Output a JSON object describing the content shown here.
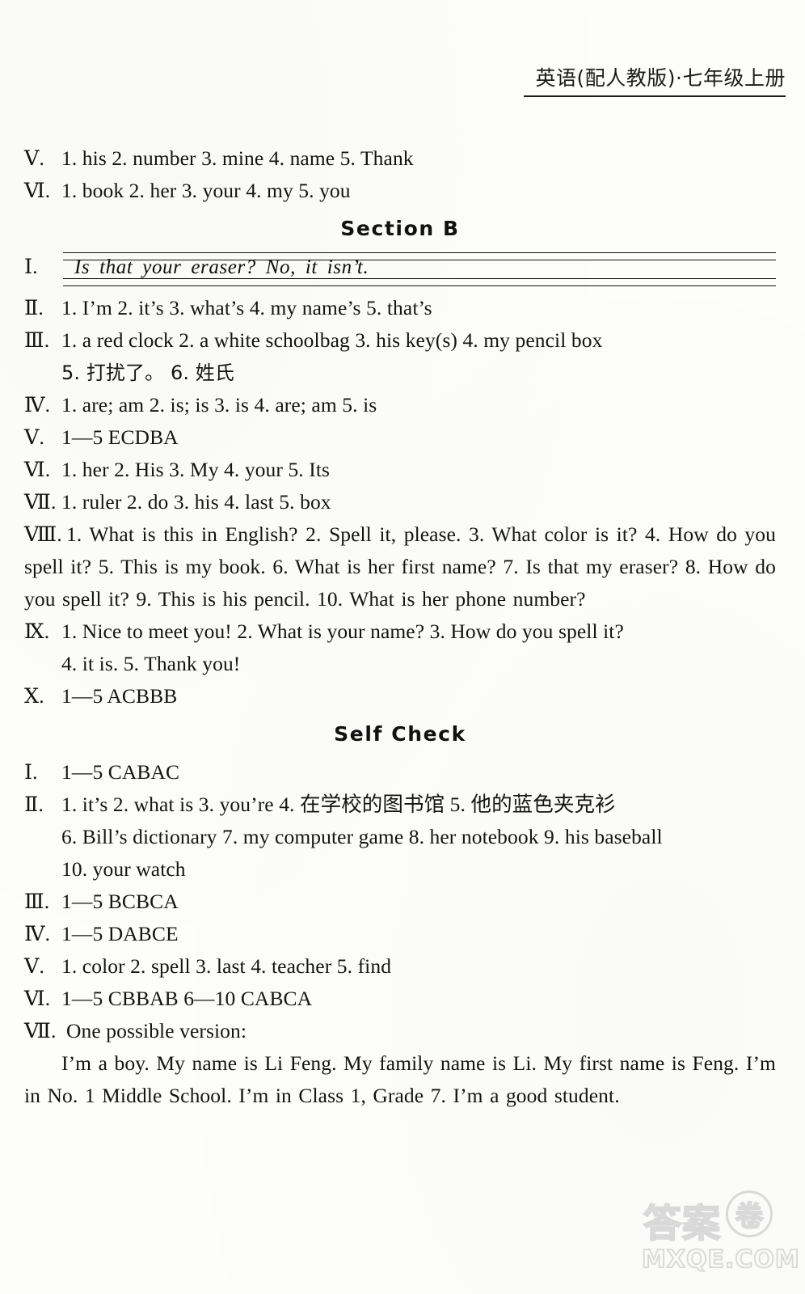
{
  "header": {
    "title": "英语(配人教版)·七年级上册"
  },
  "top_answers": [
    {
      "numeral": "Ⅴ.",
      "text": "1. his  2. number  3. mine  4. name  5. Thank"
    },
    {
      "numeral": "Ⅵ.",
      "text": "1. book  2. her  3. your  4. my  5. you"
    }
  ],
  "section_b": {
    "heading": "Section B",
    "item1": {
      "numeral": "Ⅰ.",
      "handwriting": "Is that your eraser?  No, it isn’t."
    },
    "items": [
      {
        "numeral": "Ⅱ.",
        "lines": [
          "1. I’m  2. it’s  3. what’s  4. my name’s  5. that’s"
        ]
      },
      {
        "numeral": "Ⅲ.",
        "lines": [
          "1. a red clock  2. a white schoolbag  3. his key(s)  4. my pencil box",
          "5. 打扰了。 6. 姓氏"
        ]
      },
      {
        "numeral": "Ⅳ.",
        "lines": [
          "1. are; am  2. is; is  3. is  4. are; am  5. is"
        ]
      },
      {
        "numeral": "Ⅴ.",
        "lines": [
          "1—5  ECDBA"
        ]
      },
      {
        "numeral": "Ⅵ.",
        "lines": [
          "1. her  2. His  3. My  4. your  5. Its"
        ]
      },
      {
        "numeral": "Ⅶ.",
        "lines": [
          "1. ruler  2. do  3. his  4. last  5. box"
        ]
      }
    ],
    "item8": {
      "numeral": "Ⅷ.",
      "paragraph": "1. What is this in English?  2. Spell it, please.  3. What color is it?  4. How do you spell it?  5. This is my book.  6. What is her first name?  7. Is that my eraser?  8. How do you spell it?  9. This is his pencil.  10. What is her phone number?"
    },
    "item9": {
      "numeral": "Ⅸ.",
      "line1": "1. Nice to meet you!  2. What is your name?  3. How do you spell it?",
      "line2": "4. it is.  5. Thank you!"
    },
    "item10": {
      "numeral": "Ⅹ.",
      "text": "1—5  ACBBB"
    }
  },
  "self_check": {
    "heading": "Self Check",
    "items": [
      {
        "numeral": "Ⅰ.",
        "lines": [
          "1—5  CABAC"
        ]
      },
      {
        "numeral": "Ⅱ.",
        "lines": [
          "1. it’s  2. what is  3. you’re  4. 在学校的图书馆  5. 他的蓝色夹克衫",
          "6. Bill’s dictionary  7. my computer game  8. her notebook  9. his baseball",
          "10. your watch"
        ]
      },
      {
        "numeral": "Ⅲ.",
        "lines": [
          "1—5  BCBCA"
        ]
      },
      {
        "numeral": "Ⅳ.",
        "lines": [
          "1—5  DABCE"
        ]
      },
      {
        "numeral": "Ⅴ.",
        "lines": [
          "1. color  2. spell  3. last  4. teacher  5. find"
        ]
      },
      {
        "numeral": "Ⅵ.",
        "lines": [
          "1—5  CBBAB   6—10  CABCA"
        ]
      }
    ],
    "item7": {
      "numeral": "Ⅶ.",
      "label": "One possible version:",
      "paragraph": "I’m a boy. My name is Li Feng. My family name is Li. My first name is Feng. I’m in No. 1 Middle School. I’m in Class 1, Grade 7. I’m a good student."
    }
  },
  "watermark": {
    "top": "答案",
    "circle": "卷",
    "bottom": "MXQE.COM"
  }
}
